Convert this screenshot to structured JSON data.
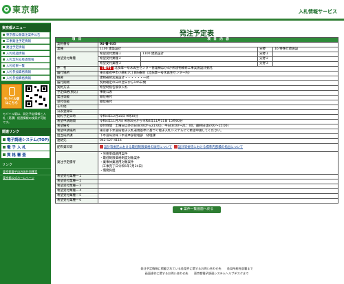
{
  "header": {
    "logo_text": "東京都",
    "site_title": "入札情報サービス"
  },
  "sidebar": {
    "section1_label": "東京都メニュー",
    "items": [
      "東京都公報発注案件公告",
      "工事発注予定情報",
      "発注予定情報",
      "入札経過情報",
      "入札案内＆経過情報",
      "入札結果一覧",
      "入札参加資格情報",
      "入札参加資格情報"
    ],
    "mobile_label": "モバイル版\nはこちら",
    "mobile_note": "モバイル版は、発注予定情報と入札（見積）経過情報の検索が可能です。",
    "section2_label": "関連リンク",
    "big_items": [
      "電子調達システム(TOP)",
      "電 子 入 札",
      "資 格 審 査"
    ],
    "links_head": "リンク",
    "links": [
      "東京都電子自治体共同運営",
      "東京都公式ホームページ"
    ]
  },
  "main": {
    "title": "発注予定表",
    "col_item": "項　目",
    "col_content": "項　目　内　容",
    "rows": {
      "contract_no_label": "契約番号",
      "contract_no": "04-番-035",
      "industry_label": "業種",
      "industry": "1100 建築設計",
      "bunya_label": "分野",
      "bunya": "16 特殊行政施設",
      "wish_label": "希望受付業種",
      "wish1_label": "希望受付業種１",
      "wish1": "1100 建築設計",
      "wish2_label": "希望受付業種２",
      "wish3_label": "希望受付業種３",
      "field1_label": "分野１",
      "field2_label": "分野２",
      "field3_label": "分野３",
      "name_label": "件　名",
      "name_badge": "【電子】",
      "name": "北多摩一号水再生センター管理棟ほか4か所建物補修工事実施設計委託",
      "place_label": "履行場所",
      "place": "東京都府中市小柳町六丁目6番地（北多摩一号水再生センター内）",
      "summary_label": "概要",
      "summary": "建物補修実施設計・・・・・・一式",
      "period_label": "履行期間",
      "period": "契約確定の日の翌日から145日間",
      "method_label": "契約方法",
      "method": "希望制指名競争入札",
      "price_label": "予定価格(税込)",
      "price": "事後公表",
      "pub_label": "発注等級",
      "pub": "順位格付",
      "acc_label": "受付等級",
      "acc": "順位格付",
      "other_label": "その他",
      "other": "",
      "ann_label": "公表登録日",
      "ann": "",
      "open_label": "開札予定日時",
      "open": "令和4年12月15日 9時30分",
      "wperiod_label": "希望申請期間",
      "wperiod": "令和4年11月7日 9時00分から令和4年11月11日 15時00分",
      "wtime_label": "希望備考",
      "wtime": "受付時間　土曜日以外の日(8:00から21:00)、平日(8:00～21：00、最終日は8:00～15:00)",
      "wmethod_label": "希望申請場所",
      "wmethod": "東京都下水道局電子入札運用基準に基づく電子入札システムにて希望申請してください。",
      "dept_label": "担当局所課",
      "dept": "下水道局流域下水道本部管理部　経理課",
      "tel_label": "連絡先",
      "tel": "042-527-4114",
      "docs_label": "配布資料等",
      "doc1": "設計等委託における最低制限価格の試行について",
      "doc2": "設計等委託における標準内部積の指出について",
      "notes_label": "発注予定備考",
      "notes": [
        "・労務単価適用案件",
        "・最低制限価格制度対象案件",
        "・業事休業適用対象案件",
        "（工事完了日令和5年7月24日）",
        "・債務負担"
      ],
      "w1_label": "希望受付業種一１",
      "w2_label": "希望受付業種一２",
      "w3_label": "希望受付業種一３",
      "w4_label": "希望受付業種一４",
      "w5_label": "希望受付業種一５",
      "w6_label": "希望受付業種一６"
    },
    "back_button": "案件一覧画面へ戻る"
  },
  "footer": {
    "line1": "発注予定情報に掲載されている各案件に関するお問い合わせ先　　各局所総合部署まで",
    "line2": "画面操作に関するお問い合わせ先　　東京都電子調達システムヘルプデスクまで"
  }
}
